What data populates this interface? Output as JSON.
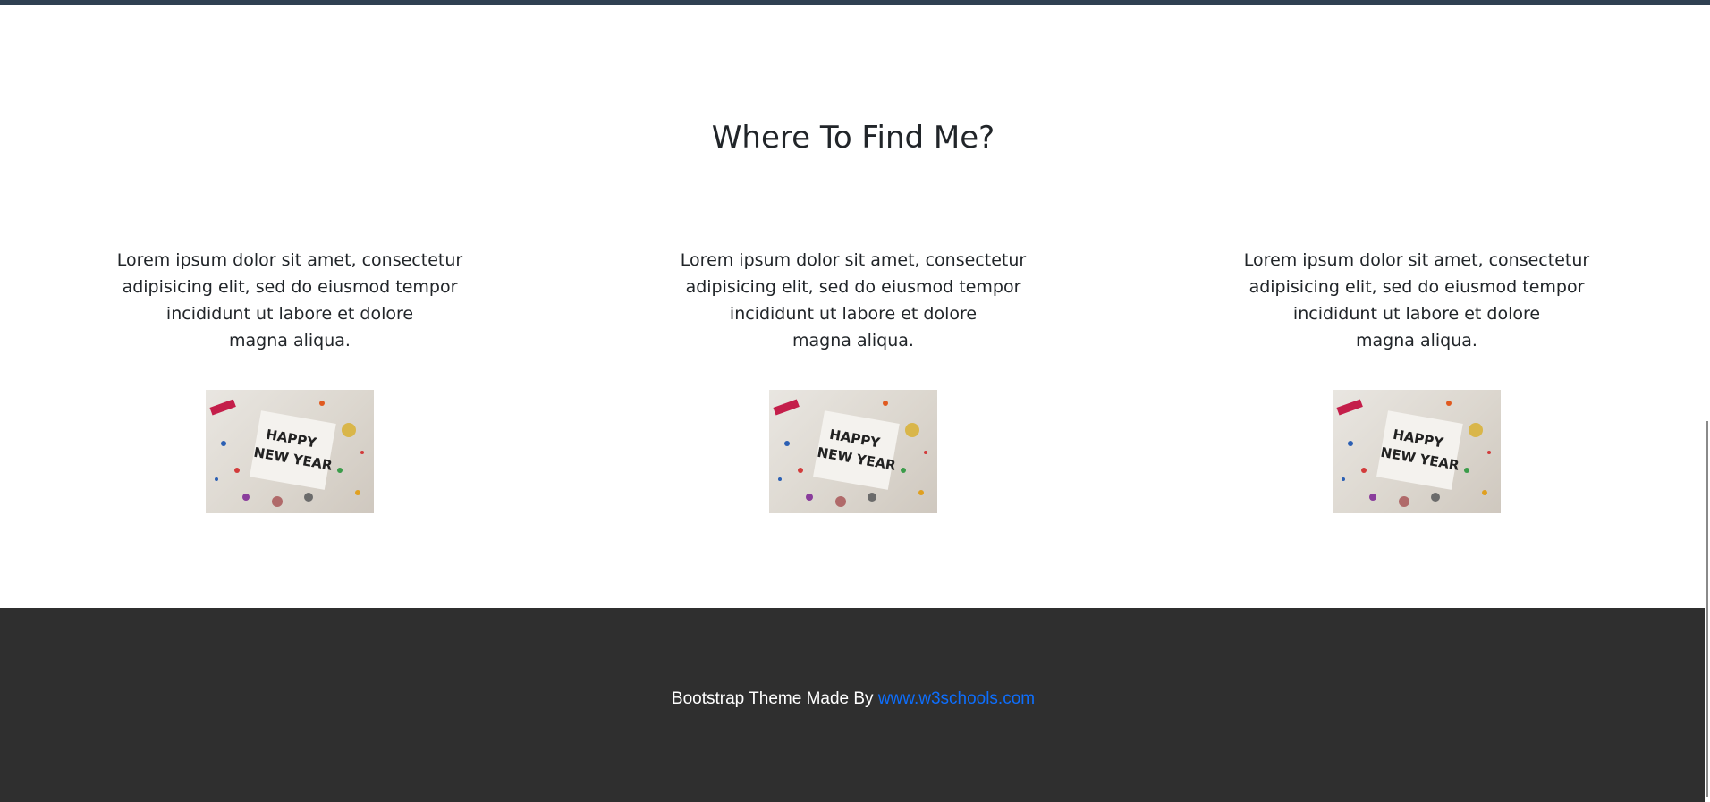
{
  "section": {
    "title": "Where To Find Me?"
  },
  "columns": [
    {
      "text_line1": "Lorem ipsum dolor sit amet, consectetur",
      "text_line2": "adipisicing elit, sed do eiusmod tempor",
      "text_line3": "incididunt ut labore et dolore",
      "text_line4": "magna aliqua.",
      "image_text": "HAPPY NEW YEAR"
    },
    {
      "text_line1": "Lorem ipsum dolor sit amet, consectetur",
      "text_line2": "adipisicing elit, sed do eiusmod tempor",
      "text_line3": "incididunt ut labore et dolore",
      "text_line4": "magna aliqua.",
      "image_text": "HAPPY NEW YEAR"
    },
    {
      "text_line1": "Lorem ipsum dolor sit amet, consectetur",
      "text_line2": "adipisicing elit, sed do eiusmod tempor",
      "text_line3": "incididunt ut labore et dolore",
      "text_line4": "magna aliqua.",
      "image_text": "HAPPY NEW YEAR"
    }
  ],
  "footer": {
    "text": "Bootstrap Theme Made By ",
    "link_text": "www.w3schools.com"
  },
  "colors": {
    "top_bar": "#2f4052",
    "footer_bg": "#2f2f2f",
    "link": "#0d6efd"
  }
}
